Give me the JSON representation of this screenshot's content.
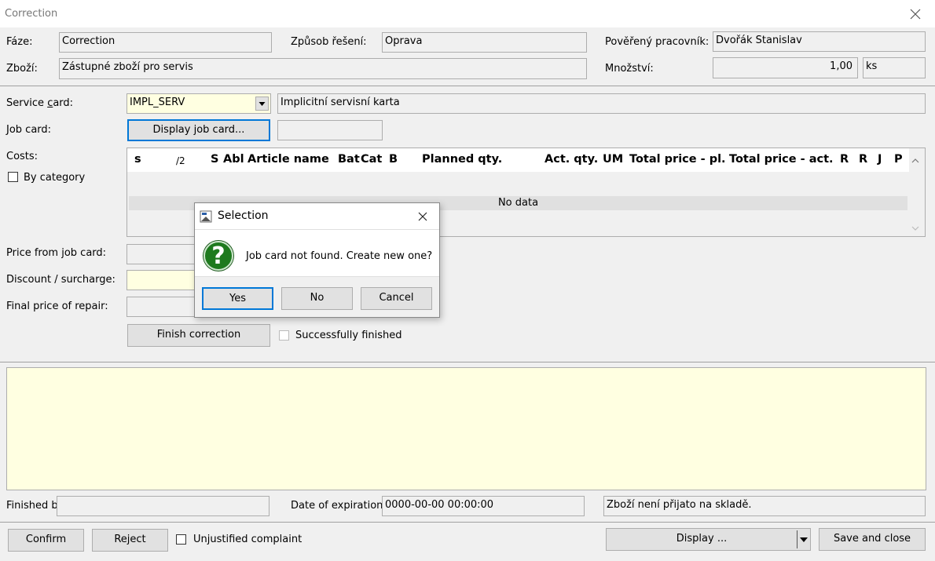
{
  "window": {
    "title": "Correction"
  },
  "header": {
    "phase_label": "Fáze:",
    "phase_value": "Correction",
    "solution_label": "Způsob řešení:",
    "solution_value": "Oprava",
    "worker_label": "Pověřený pracovník:",
    "worker_value": "Dvořák Stanislav",
    "goods_label": "Zboží:",
    "goods_value": "Zástupné zboží pro servis",
    "quantity_label": "Množství:",
    "quantity_value": "1,00",
    "unit_value": "ks"
  },
  "service": {
    "service_card_label": "Service card:",
    "service_card_value": "IMPL_SERV",
    "service_card_desc": "Implicitní servisní karta",
    "job_card_label": "Job card:",
    "display_job_card_button": "Display job card...",
    "job_card_value": ""
  },
  "costs": {
    "label": "Costs:",
    "by_category_label": "By category",
    "columns": [
      "s",
      "/2",
      "S",
      "Abl",
      "Article name",
      "Bat",
      "Cat",
      "B",
      "Planned qty.",
      "Act. qty.",
      "UM",
      "Total price - pl.",
      "Total price - act.",
      "R",
      "R",
      "J",
      "P"
    ],
    "empty_text": "No data"
  },
  "pricing": {
    "price_label": "Price from job card:",
    "discount_label": "Discount / surcharge:",
    "final_label": "Final price of repair:",
    "finish_button": "Finish correction",
    "success_label": "Successfully finished"
  },
  "footer": {
    "finished_by_label": "Finished by",
    "expiration_label": "Date of expiration:",
    "expiration_value": "0000-00-00 00:00:00",
    "status_value": "Zboží není přijato na skladě.",
    "confirm_button": "Confirm",
    "reject_button": "Reject",
    "unjustified_label": "Unjustified complaint",
    "display_button": "Display ...",
    "save_close_button": "Save and close"
  },
  "dialog": {
    "title": "Selection",
    "icon_glyph": "?",
    "message": "Job card not found. Create new one?",
    "yes": "Yes",
    "no": "No",
    "cancel": "Cancel"
  },
  "colors": {
    "yellow_field": "#ffffe1",
    "question_icon": "#1e7a1e",
    "focus_border": "#0078d7"
  }
}
